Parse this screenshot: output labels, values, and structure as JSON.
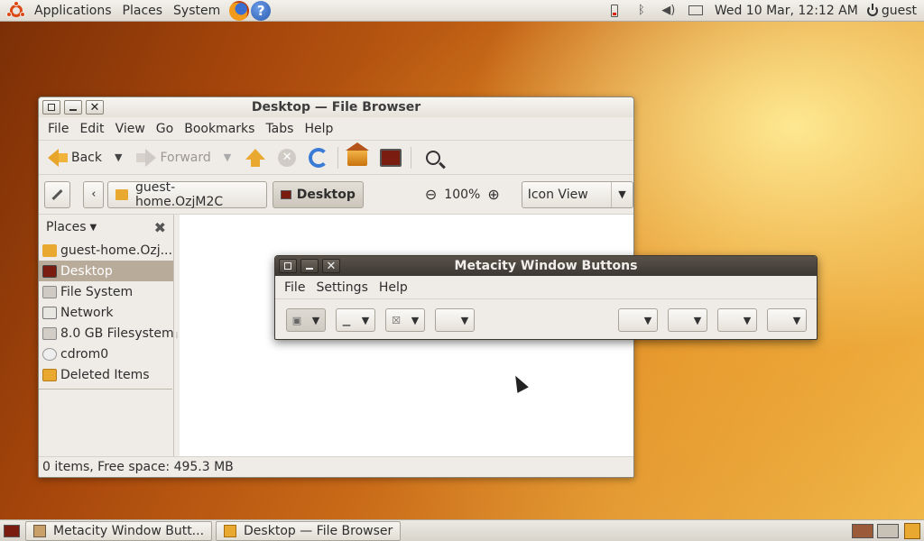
{
  "top_panel": {
    "menus": [
      "Applications",
      "Places",
      "System"
    ],
    "clock": "Wed 10 Mar, 12:12 AM",
    "user": "guest"
  },
  "file_browser": {
    "title": "Desktop — File Browser",
    "menu": [
      "File",
      "Edit",
      "View",
      "Go",
      "Bookmarks",
      "Tabs",
      "Help"
    ],
    "toolbar": {
      "back": "Back",
      "forward": "Forward"
    },
    "path": {
      "home": "guest-home.OzjM2C",
      "current": "Desktop"
    },
    "zoom": "100%",
    "view_mode": "Icon View",
    "sidebar": {
      "header": "Places",
      "items": [
        {
          "label": "guest-home.Ozj..."
        },
        {
          "label": "Desktop"
        },
        {
          "label": "File System"
        },
        {
          "label": "Network"
        },
        {
          "label": "8.0 GB Filesystem"
        },
        {
          "label": "cdrom0"
        },
        {
          "label": "Deleted Items"
        }
      ]
    },
    "status": "0 items, Free space: 495.3 MB"
  },
  "metacity": {
    "title": "Metacity Window Buttons",
    "menu": [
      "File",
      "Settings",
      "Help"
    ]
  },
  "taskbar": {
    "tasks": [
      "Metacity Window Butt...",
      "Desktop — File Browser"
    ]
  },
  "colors": {
    "selection": "#b8ab9a",
    "accent_orange": "#e9a830",
    "dark_titlebar": "#3c3832"
  }
}
